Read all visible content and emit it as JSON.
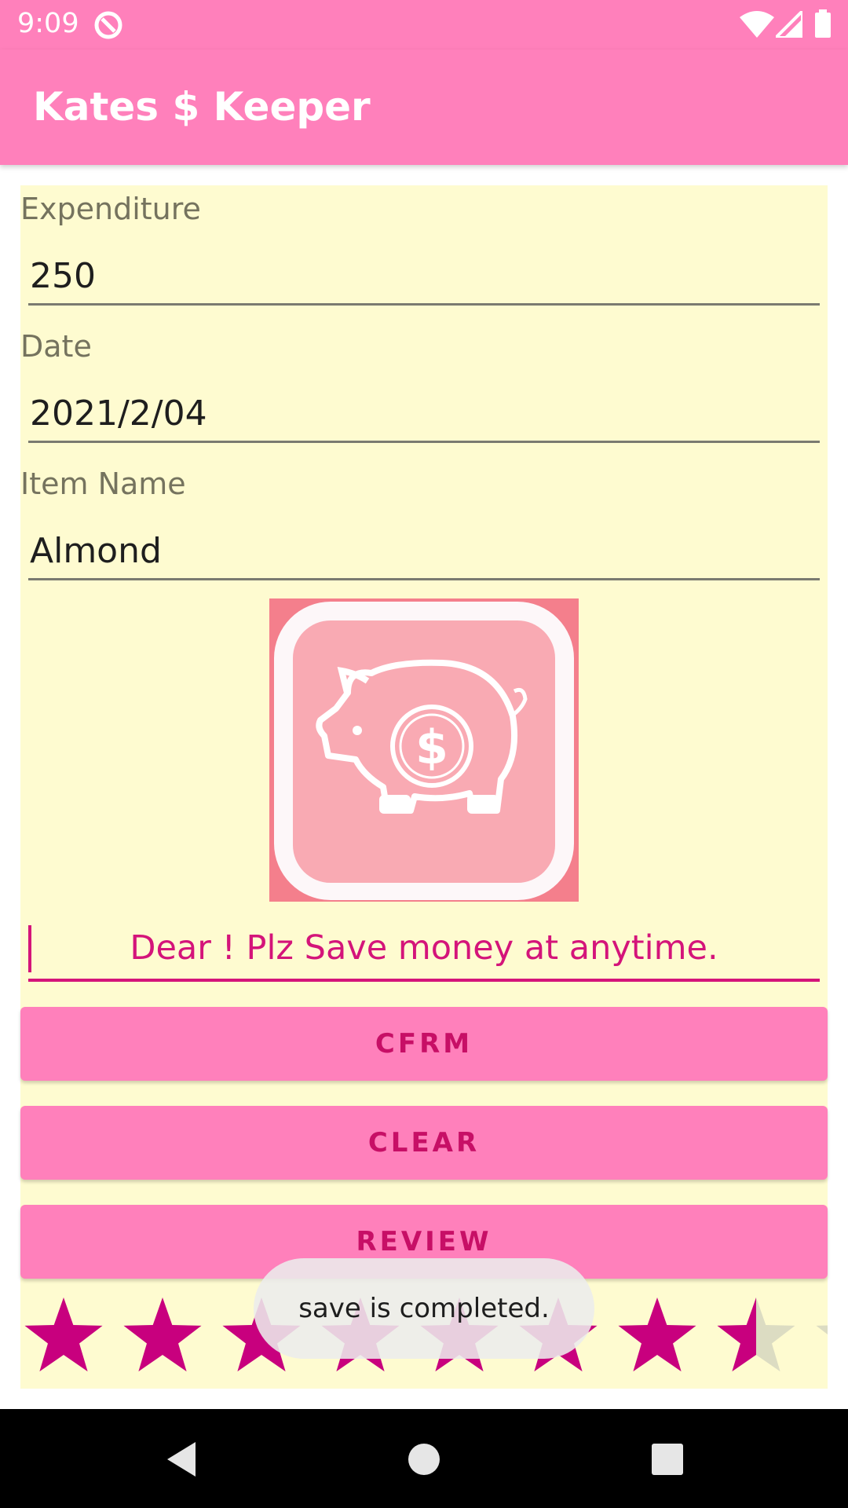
{
  "status_bar": {
    "time": "9:09"
  },
  "app_bar": {
    "title": "Kates $ Keeper"
  },
  "form": {
    "expenditure_label": "Expenditure",
    "expenditure_value": "250",
    "date_label": "Date",
    "date_value": "2021/2/04",
    "item_label": "Item Name",
    "item_value": "Almond",
    "message": "Dear ! Plz Save money at anytime."
  },
  "buttons": {
    "confirm": "CFRM",
    "clear": "CLEAR",
    "review": "REVIEW"
  },
  "rating": {
    "stars_filled": 7.5,
    "stars_total": 9
  },
  "toast": "save is completed.",
  "colors": {
    "primary": "#ff80bb",
    "accent": "#d4147a",
    "panel_bg": "#fefbd0",
    "star": "#c8007e"
  }
}
